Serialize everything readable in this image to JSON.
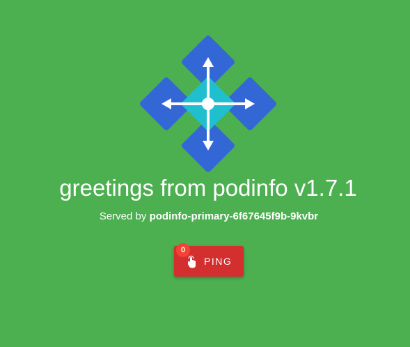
{
  "header": {
    "title": "greetings from podinfo v1.7.1"
  },
  "served": {
    "prefix": "Served by",
    "hostname": "podinfo-primary-6f67645f9b-9kvbr"
  },
  "ping": {
    "label": "PING",
    "count": "0"
  },
  "colors": {
    "background": "#4caf50",
    "logo_blue": "#3367d6",
    "logo_cyan": "#1fbfcf",
    "button": "#d32f2f",
    "badge": "#f44336"
  },
  "icons": {
    "logo": "podinfo-logo-icon",
    "ping": "touch-hand-icon"
  }
}
